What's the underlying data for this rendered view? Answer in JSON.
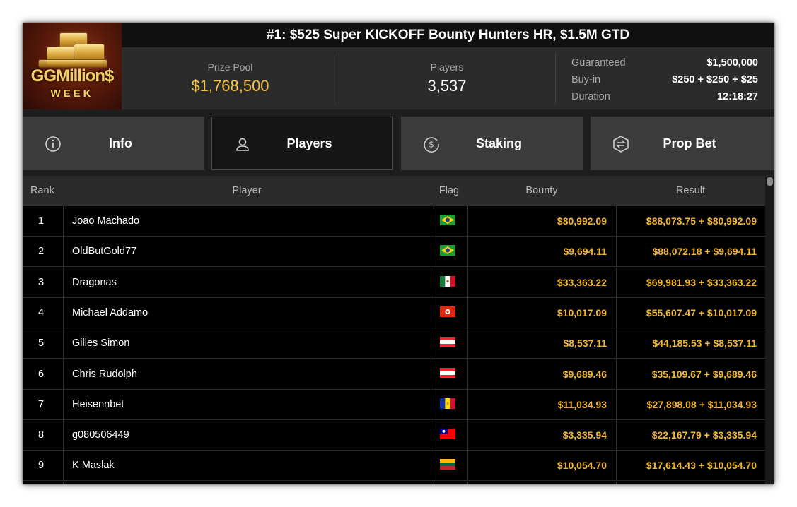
{
  "header": {
    "logo_text_main": "GGMillion$",
    "logo_text_sub": "WEEK",
    "title": "#1: $525 Super KICKOFF Bounty Hunters HR, $1.5M GTD"
  },
  "stats": {
    "prize_pool_label": "Prize Pool",
    "prize_pool_value": "$1,768,500",
    "players_label": "Players",
    "players_value": "3,537",
    "guaranteed_label": "Guaranteed",
    "guaranteed_value": "$1,500,000",
    "buyin_label": "Buy-in",
    "buyin_value": "$250 + $250 + $25",
    "duration_label": "Duration",
    "duration_value": "12:18:27"
  },
  "tabs": [
    {
      "label": "Info",
      "icon": "info-icon"
    },
    {
      "label": "Players",
      "icon": "user-icon",
      "active": true
    },
    {
      "label": "Staking",
      "icon": "dollar-circle-icon"
    },
    {
      "label": "Prop Bet",
      "icon": "prop-bet-icon"
    }
  ],
  "columns": {
    "rank": "Rank",
    "player": "Player",
    "flag": "Flag",
    "bounty": "Bounty",
    "result": "Result"
  },
  "rows": [
    {
      "rank": "1",
      "player": "Joao Machado",
      "flag": "brazil",
      "bounty": "$80,992.09",
      "result": "$88,073.75 + $80,992.09"
    },
    {
      "rank": "2",
      "player": "OldButGold77",
      "flag": "brazil",
      "bounty": "$9,694.11",
      "result": "$88,072.18 + $9,694.11"
    },
    {
      "rank": "3",
      "player": "Dragonas",
      "flag": "mexico",
      "bounty": "$33,363.22",
      "result": "$69,981.93 + $33,363.22"
    },
    {
      "rank": "4",
      "player": "Michael Addamo",
      "flag": "hong-kong",
      "bounty": "$10,017.09",
      "result": "$55,607.47 + $10,017.09"
    },
    {
      "rank": "5",
      "player": "Gilles Simon",
      "flag": "austria",
      "bounty": "$8,537.11",
      "result": "$44,185.53 + $8,537.11"
    },
    {
      "rank": "6",
      "player": "Chris Rudolph",
      "flag": "austria",
      "bounty": "$9,689.46",
      "result": "$35,109.67 + $9,689.46"
    },
    {
      "rank": "7",
      "player": "Heisennbet",
      "flag": "andorra",
      "bounty": "$11,034.93",
      "result": "$27,898.08 + $11,034.93"
    },
    {
      "rank": "8",
      "player": "g080506449",
      "flag": "taiwan",
      "bounty": "$3,335.94",
      "result": "$22,167.79 + $3,335.94"
    },
    {
      "rank": "9",
      "player": "K Maslak",
      "flag": "lithuania",
      "bounty": "$10,054.70",
      "result": "$17,614.43 + $10,054.70"
    }
  ],
  "colors": {
    "gold": "#f2b630",
    "prize_gold": "#f5c242"
  }
}
